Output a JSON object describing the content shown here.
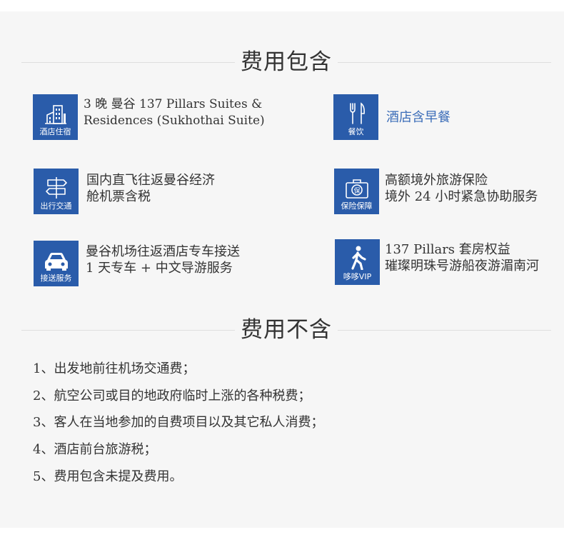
{
  "included": {
    "title": "费用包含",
    "items": [
      {
        "icon": "building-icon",
        "tile_label": "酒店住宿",
        "lines": [
          "3 晚 曼谷 137 Pillars Suites &",
          "Residences (Sukhothai Suite)"
        ]
      },
      {
        "icon": "fork-knife-icon",
        "tile_label": "餐饮",
        "lines": [
          "酒店含早餐"
        ]
      },
      {
        "icon": "signpost-icon",
        "tile_label": "出行交通",
        "lines": [
          "国内直飞往返曼谷经济",
          "舱机票含税"
        ]
      },
      {
        "icon": "insurance-kit-icon",
        "tile_label": "保险保障",
        "lines": [
          "高额境外旅游保险",
          "境外 24 小时紧急协助服务"
        ]
      },
      {
        "icon": "car-icon",
        "tile_label": "接送服务",
        "lines": [
          "曼谷机场往返酒店专车接送",
          "1 天专车 + 中文导游服务"
        ]
      },
      {
        "icon": "walking-person-icon",
        "tile_label": "哆哆VIP",
        "lines": [
          "137 Pillars 套房权益",
          "璀璨明珠号游船夜游湄南河"
        ]
      }
    ]
  },
  "excluded": {
    "title": "费用不含",
    "items": [
      "1、出发地前往机场交通费；",
      "2、航空公司或目的地政府临时上涨的各种税费；",
      "3、客人在当地参加的自费项目以及其它私人消费；",
      "4、酒店前台旅游税；",
      "5、费用包含未提及费用。"
    ]
  },
  "colors": {
    "tile": "#2a5caa",
    "accent_text": "#3a6cb8",
    "panel": "#f6f6f6",
    "rule": "#dedede"
  }
}
